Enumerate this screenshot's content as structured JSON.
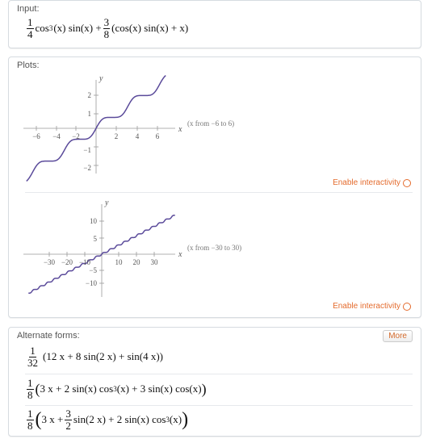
{
  "input_pod": {
    "title": "Input:",
    "expression": {
      "f1_num": "1",
      "f1_den": "4",
      "t1": "cos",
      "t1_sup": "3",
      "t1_rest": "(x) sin(x) +",
      "f2_num": "3",
      "f2_den": "8",
      "t2": "(cos(x) sin(x) + x)"
    }
  },
  "plots_pod": {
    "title": "Plots:",
    "plot1": {
      "range_label": "(x from −6 to 6)",
      "x_label": "x",
      "y_label": "y",
      "x_ticks": [
        "−6",
        "−4",
        "−2",
        "2",
        "4",
        "6"
      ],
      "y_ticks": [
        "2",
        "1",
        "−1",
        "−2"
      ],
      "enable_label": "Enable interactivity"
    },
    "plot2": {
      "range_label": "(x from −30 to 30)",
      "x_label": "x",
      "y_label": "y",
      "x_ticks": [
        "−30",
        "−20",
        "−10",
        "10",
        "20",
        "30"
      ],
      "y_ticks": [
        "10",
        "5",
        "−5",
        "−10"
      ],
      "enable_label": "Enable interactivity"
    }
  },
  "alternate_pod": {
    "title": "Alternate forms:",
    "more_label": "More",
    "form1": {
      "num": "1",
      "den": "32",
      "body": "(12 x + 8 sin(2 x) + sin(4 x))"
    },
    "form2": {
      "num": "1",
      "den": "8",
      "lparen": "(",
      "body_a": "3 x + 2 sin(x) cos",
      "sup": "3",
      "body_b": "(x) + 3 sin(x) cos(x)",
      "rparen": ")"
    },
    "form3": {
      "num": "1",
      "den": "8",
      "lparen": "(",
      "body_a": "3 x +",
      "inner_num": "3",
      "inner_den": "2",
      "body_b": "sin(2 x) + 2 sin(x) cos",
      "sup": "3",
      "body_c": "(x)",
      "rparen": ")"
    }
  },
  "colors": {
    "accent": "#e46b2d",
    "curve": "#5a4a9a",
    "axis": "#999999"
  }
}
